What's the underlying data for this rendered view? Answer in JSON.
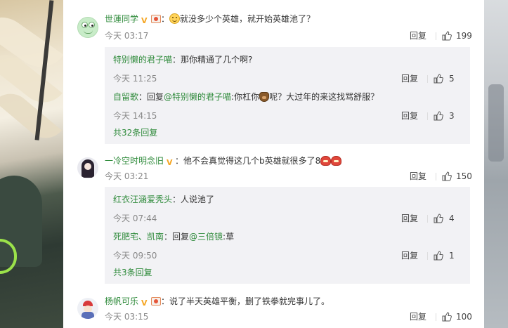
{
  "threads": [
    {
      "user": "世蓮同学",
      "text": "就没多少个英雄，就开始英雄池了？",
      "time": "今天 03:17",
      "reply_label": "回复",
      "likes": "199",
      "replies": [
        {
          "user": "特别懒的君子喵",
          "text": "：那你精通了几个啊?",
          "time": "今天 11:25",
          "reply_label": "回复",
          "likes": "5"
        },
        {
          "user": "自留歌",
          "text_a": "：回复",
          "mention": "@特别懒的君子喵",
          "text_b": ":你杠你",
          "text_c": "呢？大过年的来这找骂舒服？",
          "time": "今天 14:15",
          "reply_label": "回复",
          "likes": "3"
        }
      ],
      "more_label": "共32条回复"
    },
    {
      "user": "一冷空时明念旧",
      "text": "：他不会真觉得这几个b英雄就很多了8",
      "time": "今天 03:21",
      "reply_label": "回复",
      "likes": "150",
      "replies": [
        {
          "user": "红衣汪涵爱秃头",
          "text": "：人说池了",
          "time": "今天 07:44",
          "reply_label": "回复",
          "likes": "4"
        },
        {
          "user": "死肥宅、凯南",
          "text_a": "：回复",
          "mention": "@三倍镜",
          "text_b": ":草",
          "time": "今天 09:50",
          "reply_label": "回复",
          "likes": "1"
        }
      ],
      "more_label": "共3条回复"
    },
    {
      "user": "杨帆可乐",
      "text": "：说了半天英雄平衡，删了铁拳就完事儿了。",
      "time": "今天 03:15",
      "reply_label": "回复",
      "likes": "100"
    }
  ],
  "colors": {
    "username": "#2e8a3a",
    "sub_bg": "#f2f2f5",
    "time": "#888888"
  },
  "icons": {
    "like": "thumbs-up-icon",
    "verified": "verified-v-icon",
    "vip": "vip-badge-icon"
  }
}
